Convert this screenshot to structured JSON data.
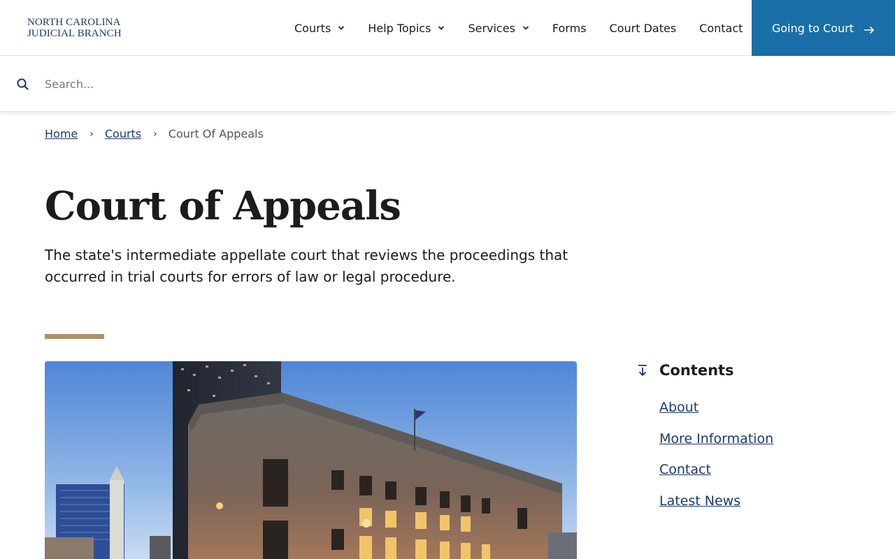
{
  "logo": {
    "line1": "NORTH CAROLINA",
    "line2": "JUDICIAL BRANCH"
  },
  "nav": {
    "items": [
      {
        "label": "Courts",
        "dropdown": true
      },
      {
        "label": "Help Topics",
        "dropdown": true
      },
      {
        "label": "Services",
        "dropdown": true
      },
      {
        "label": "Forms",
        "dropdown": false
      },
      {
        "label": "Court Dates",
        "dropdown": false
      },
      {
        "label": "Contact",
        "dropdown": false
      }
    ],
    "cta_label": "Going to Court"
  },
  "search": {
    "placeholder": "Search...",
    "value": ""
  },
  "breadcrumb": {
    "home": "Home",
    "courts": "Courts",
    "current": "Court Of Appeals",
    "separator": "›"
  },
  "page": {
    "title": "Court of Appeals",
    "lead": "The state's intermediate appellate court that reviews the proceedings that occurred in trial courts for errors of law or legal procedure."
  },
  "contents": {
    "title": "Contents",
    "items": [
      "About",
      "More Information",
      "Contact",
      "Latest News"
    ]
  },
  "colors": {
    "brand_navy": "#1b3a6b",
    "cta_blue": "#1a6fa8",
    "accent_tan": "#a8936a",
    "link": "#1b3a6b"
  },
  "icons": {
    "dropdown": "chevron-down-icon",
    "cta": "arrow-right-icon",
    "search": "search-icon",
    "contents": "arrow-down-to-line-icon",
    "separator": "chevron-right-icon"
  }
}
